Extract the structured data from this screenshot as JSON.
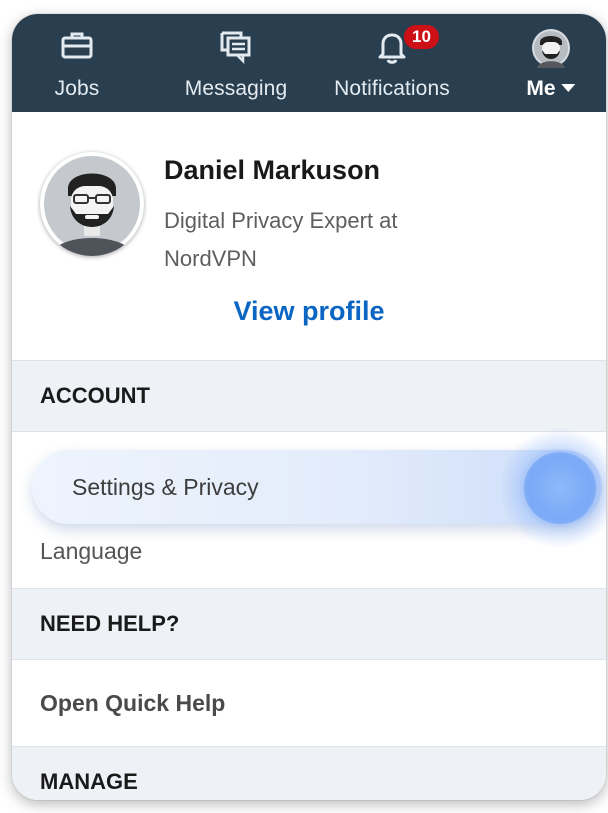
{
  "nav": {
    "jobs_label": "Jobs",
    "jobs_icon": "briefcase-icon",
    "messaging_label": "Messaging",
    "messaging_icon": "messaging-icon",
    "notifications_label": "Notifications",
    "notifications_icon": "bell-icon",
    "notifications_count": "10",
    "me_label": "Me",
    "me_icon": "avatar"
  },
  "profile": {
    "name": "Daniel Markuson",
    "headline": "Digital Privacy Expert at NordVPN",
    "view_profile_label": "View profile"
  },
  "sections": {
    "account_header": "ACCOUNT",
    "settings_label": "Settings & Privacy",
    "language_label": "Language",
    "help_header": "NEED HELP?",
    "quick_help_label": "Open Quick Help",
    "manage_header": "MANAGE"
  },
  "colors": {
    "nav_background": "#293e4f",
    "link_blue": "#0a66c2",
    "badge_red": "#cc1016",
    "section_background": "#eef2f6"
  }
}
